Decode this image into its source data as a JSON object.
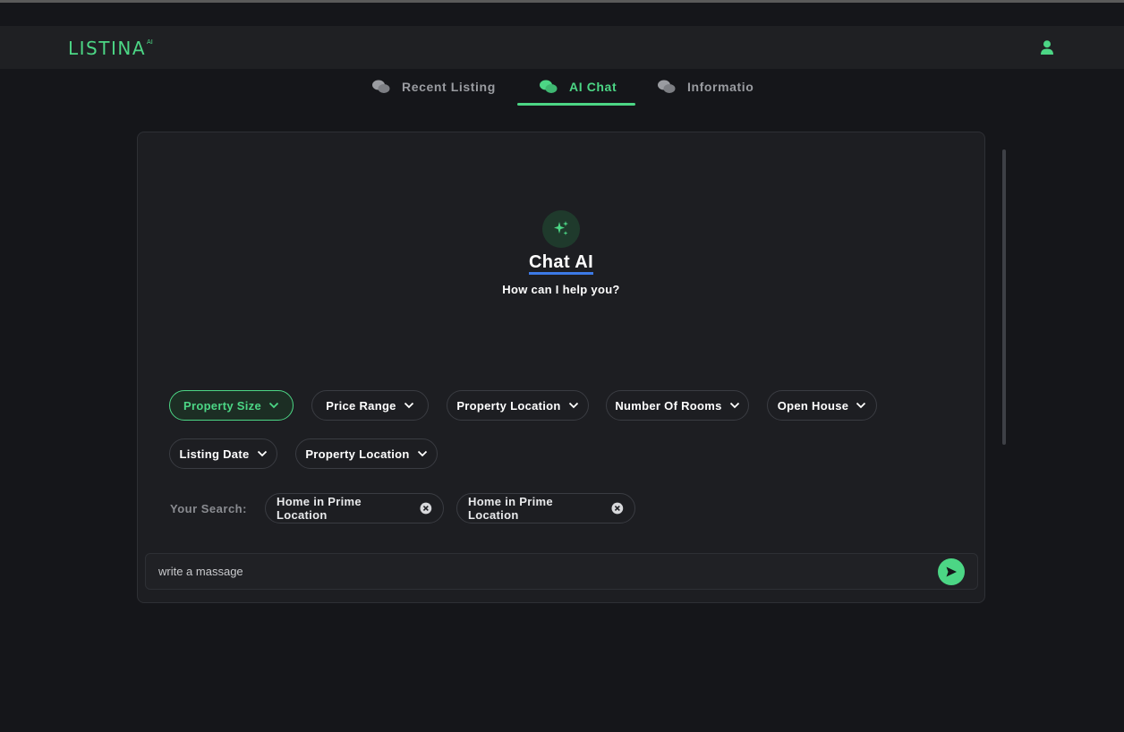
{
  "app": {
    "logo_text": "LISTINA",
    "logo_superscript": "AI",
    "accent_color": "#4cd685"
  },
  "header": {
    "user_icon": "user-icon"
  },
  "tabs": [
    {
      "label": "Recent Listing",
      "icon": "chat-bubbles-icon",
      "active": false
    },
    {
      "label": "AI Chat",
      "icon": "chat-bubbles-icon",
      "active": true
    },
    {
      "label": "Informatio",
      "icon": "chat-bubbles-icon",
      "active": false
    }
  ],
  "chat": {
    "icon": "sparkles-icon",
    "title": "Chat AI",
    "subtitle": "How can I help you?"
  },
  "filters": [
    {
      "label": "Property Size",
      "active": true
    },
    {
      "label": "Price Range",
      "active": false
    },
    {
      "label": "Property Location",
      "active": false
    },
    {
      "label": "Number Of Rooms",
      "active": false
    },
    {
      "label": "Open House",
      "active": false
    },
    {
      "label": "Listing Date",
      "active": false
    },
    {
      "label": "Property Location",
      "active": false
    }
  ],
  "search": {
    "label": "Your Search:",
    "tags": [
      "Home in Prime Location",
      "Home in Prime Location"
    ]
  },
  "composer": {
    "placeholder": "write a massage",
    "value": "",
    "send_icon": "send-icon"
  }
}
